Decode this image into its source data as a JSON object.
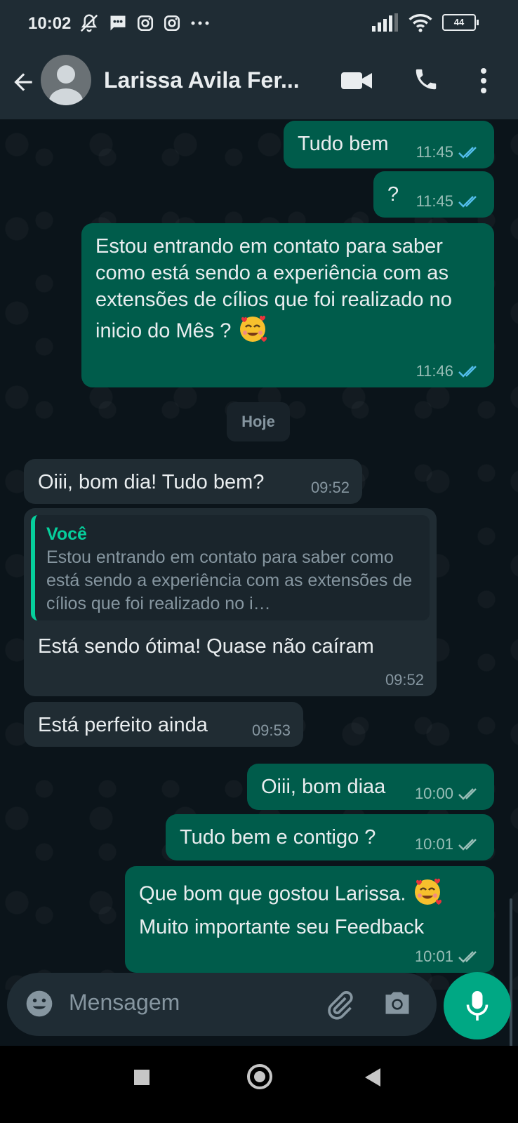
{
  "status_bar": {
    "time": "10:02",
    "battery": "44"
  },
  "header": {
    "contact_name": "Larissa Avila Fer..."
  },
  "chat": {
    "messages": [
      {
        "text": "Tudo bem",
        "time": "11:45"
      },
      {
        "text": "?",
        "time": "11:45"
      },
      {
        "text": "Estou entrando em contato para saber como está sendo a experiência com as extensões de cílios que foi realizado no inicio do Mês ?",
        "time": "11:46",
        "emoji": "🥰"
      },
      {
        "text": "Oiii, bom dia! Tudo bem?",
        "time": "09:52"
      },
      {
        "text": "Está sendo ótima! Quase não caíram",
        "time": "09:52",
        "quote": {
          "author": "Você",
          "text": "Estou entrando em contato para saber como está sendo a experiência com as extensões de cílios que foi realizado no i…"
        }
      },
      {
        "text": "Está perfeito ainda",
        "time": "09:53"
      },
      {
        "text": "Oiii, bom diaa",
        "time": "10:00"
      },
      {
        "text": "Tudo bem e contigo ?",
        "time": "10:01"
      },
      {
        "text": "Que bom que gostou Larissa.",
        "text2": "Muito importante seu Feedback",
        "time": "10:01",
        "emoji": "🥰"
      }
    ],
    "date_divider": "Hoje"
  },
  "composer": {
    "placeholder": "Mensagem"
  },
  "colors": {
    "outgoing_bubble": "#005c4b",
    "incoming_bubble": "#202c33",
    "read_ticks": "#53bdeb",
    "accent": "#00a884"
  }
}
